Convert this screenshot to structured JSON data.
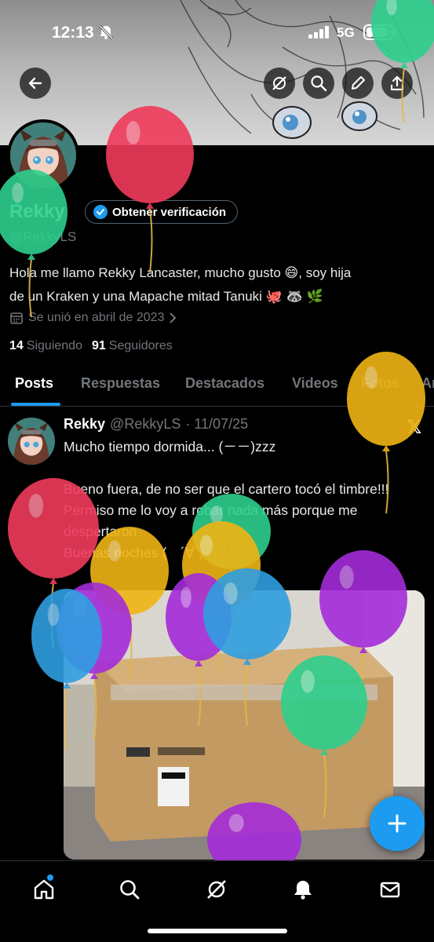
{
  "status_bar": {
    "time": "12:13",
    "network": "5G",
    "battery_level": 0.9
  },
  "profile": {
    "name": "Rekky",
    "verify_label": "Obtener verificación",
    "handle": "@RekkyLS",
    "bio_line1": "Hola me llamo Rekky Lancaster, mucho gusto 😄, soy hija",
    "bio_line2": "de un Kraken y una Mapache mitad Tanuki 🐙 🦝 🌿",
    "joined": "Se unió en abril de 2023",
    "following_count": "14",
    "following_label": "Siguiendo",
    "followers_count": "91",
    "followers_label": "Seguidores"
  },
  "tabs": [
    "Posts",
    "Respuestas",
    "Destacados",
    "Videos",
    "Fotos",
    "Ar"
  ],
  "post": {
    "name": "Rekky",
    "handle": "@RekkyLS",
    "date": "· 11/07/25",
    "x_logo": "𝕏",
    "text": "Mucho tiempo dormida... (－－)zzz\n\nBueno fuera, de no ser que el cartero tocó el timbre!!!\nPermiso me lo voy a robar nada más porque me despertaron\nBuenas noches (　´∀`)ﾉ⚡┸┸"
  },
  "icons": {
    "back": "back-arrow-icon",
    "grok": "grok-icon",
    "search": "search-icon",
    "edit": "pencil-icon",
    "share": "share-icon",
    "nav": [
      "home-icon",
      "search-icon",
      "grok-icon",
      "bell-icon",
      "mail-icon"
    ],
    "fab": "plus-icon"
  },
  "colors": {
    "accent": "#1d9bf0",
    "background": "#000000",
    "muted": "#71767b",
    "border": "#2f3336"
  }
}
